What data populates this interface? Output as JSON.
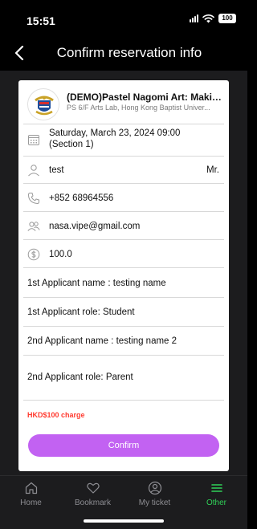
{
  "status_bar": {
    "time": "15:51",
    "battery": "100"
  },
  "header": {
    "title": "Confirm reservation info"
  },
  "event": {
    "title": "(DEMO)Pastel Nagomi Art: Making...",
    "venue": "PS 6/F Arts Lab, Hong Kong Baptist Univer..."
  },
  "details": {
    "date_line1": "Saturday, March 23, 2024 09:00",
    "date_line2": "(Section 1)",
    "name": "test",
    "title": "Mr.",
    "phone": "+852 68964556",
    "email": "nasa.vipe@gmail.com",
    "price": "100.0"
  },
  "applicants": [
    "1st Applicant name : testing name",
    "1st Applicant role: Student",
    "2nd Applicant name : testing name 2",
    "2nd Applicant role: Parent"
  ],
  "charge": "HKD$100 charge",
  "confirm_label": "Confirm",
  "tabs": [
    {
      "label": "Home",
      "icon": "home-icon"
    },
    {
      "label": "Bookmark",
      "icon": "heart-icon"
    },
    {
      "label": "My ticket",
      "icon": "user-circle-icon"
    },
    {
      "label": "Other",
      "icon": "menu-icon"
    }
  ],
  "colors": {
    "accent": "#c262f2",
    "active_tab": "#30d158",
    "charge": "#ff3b30"
  }
}
